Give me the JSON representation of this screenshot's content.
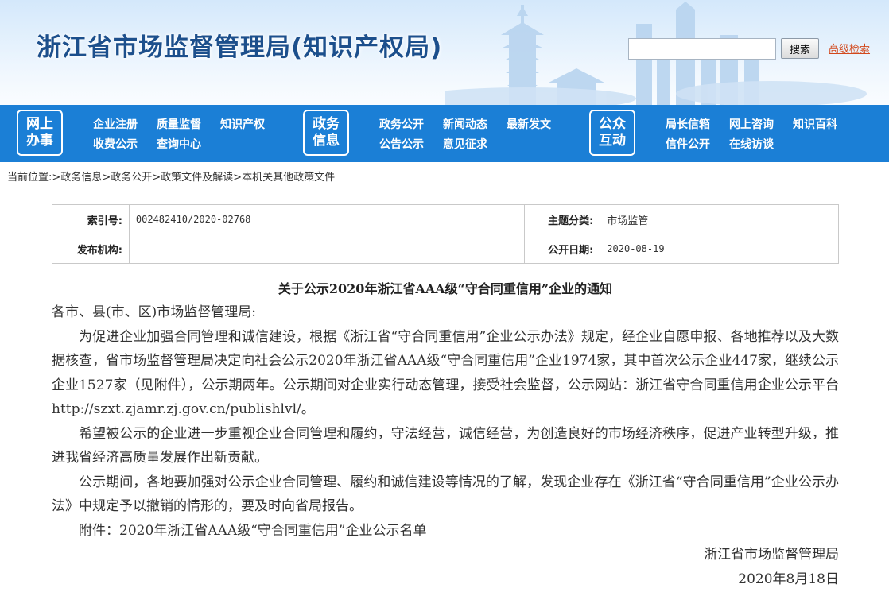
{
  "header": {
    "title": "浙江省市场监督管理局(知识产权局)",
    "search": {
      "placeholder": "",
      "button_label": "搜索"
    },
    "advanced_search_label": "高级检索"
  },
  "nav": {
    "groups": [
      {
        "box_label": "网上办事",
        "links": [
          "企业注册",
          "质量监督",
          "知识产权",
          "收费公示",
          "查询中心"
        ]
      },
      {
        "box_label": "政务信息",
        "links": [
          "政务公开",
          "新闻动态",
          "最新发文",
          "公告公示",
          "意见征求"
        ]
      },
      {
        "box_label": "公众互动",
        "links": [
          "局长信箱",
          "网上咨询",
          "知识百科",
          "信件公开",
          "在线访谈"
        ]
      }
    ]
  },
  "breadcrumb": {
    "prefix": "当前位置:",
    "items": [
      "政务信息",
      "政务公开",
      "政策文件及解读",
      "本机关其他政策文件"
    ]
  },
  "info": {
    "index_label": "索引号:",
    "index_value": "002482410/2020-02768",
    "topic_label": "主题分类:",
    "topic_value": "市场监管",
    "issuer_label": "发布机构:",
    "issuer_value": "",
    "date_label": "公开日期:",
    "date_value": "2020-08-19"
  },
  "article": {
    "title": "关于公示2020年浙江省AAA级“守合同重信用”企业的通知",
    "salutation": "各市、县(市、区)市场监督管理局:",
    "paragraphs": [
      "为促进企业加强合同管理和诚信建设，根据《浙江省“守合同重信用”企业公示办法》规定，经企业自愿申报、各地推荐以及大数据核查，省市场监督管理局决定向社会公示2020年浙江省AAA级“守合同重信用”企业1974家，其中首次公示企业447家，继续公示企业1527家（见附件），公示期两年。公示期间对企业实行动态管理，接受社会监督，公示网站：浙江省守合同重信用企业公示平台http://szxt.zjamr.zj.gov.cn/publishlvl/。",
      "希望被公示的企业进一步重视企业合同管理和履约，守法经营，诚信经营，为创造良好的市场经济秩序，促进产业转型升级，推进我省经济高质量发展作出新贡献。",
      "公示期间，各地要加强对公示企业合同管理、履约和诚信建设等情况的了解，发现企业存在《浙江省“守合同重信用”企业公示办法》中规定予以撤销的情形的，要及时向省局报告。",
      "附件：2020年浙江省AAA级“守合同重信用”企业公示名单"
    ],
    "signature": "浙江省市场监督管理局",
    "date": "2020年8月18日"
  },
  "colors": {
    "nav_bg": "#1b7fd6",
    "title_blue": "#1c4f8c",
    "link_orange": "#d2481c"
  }
}
